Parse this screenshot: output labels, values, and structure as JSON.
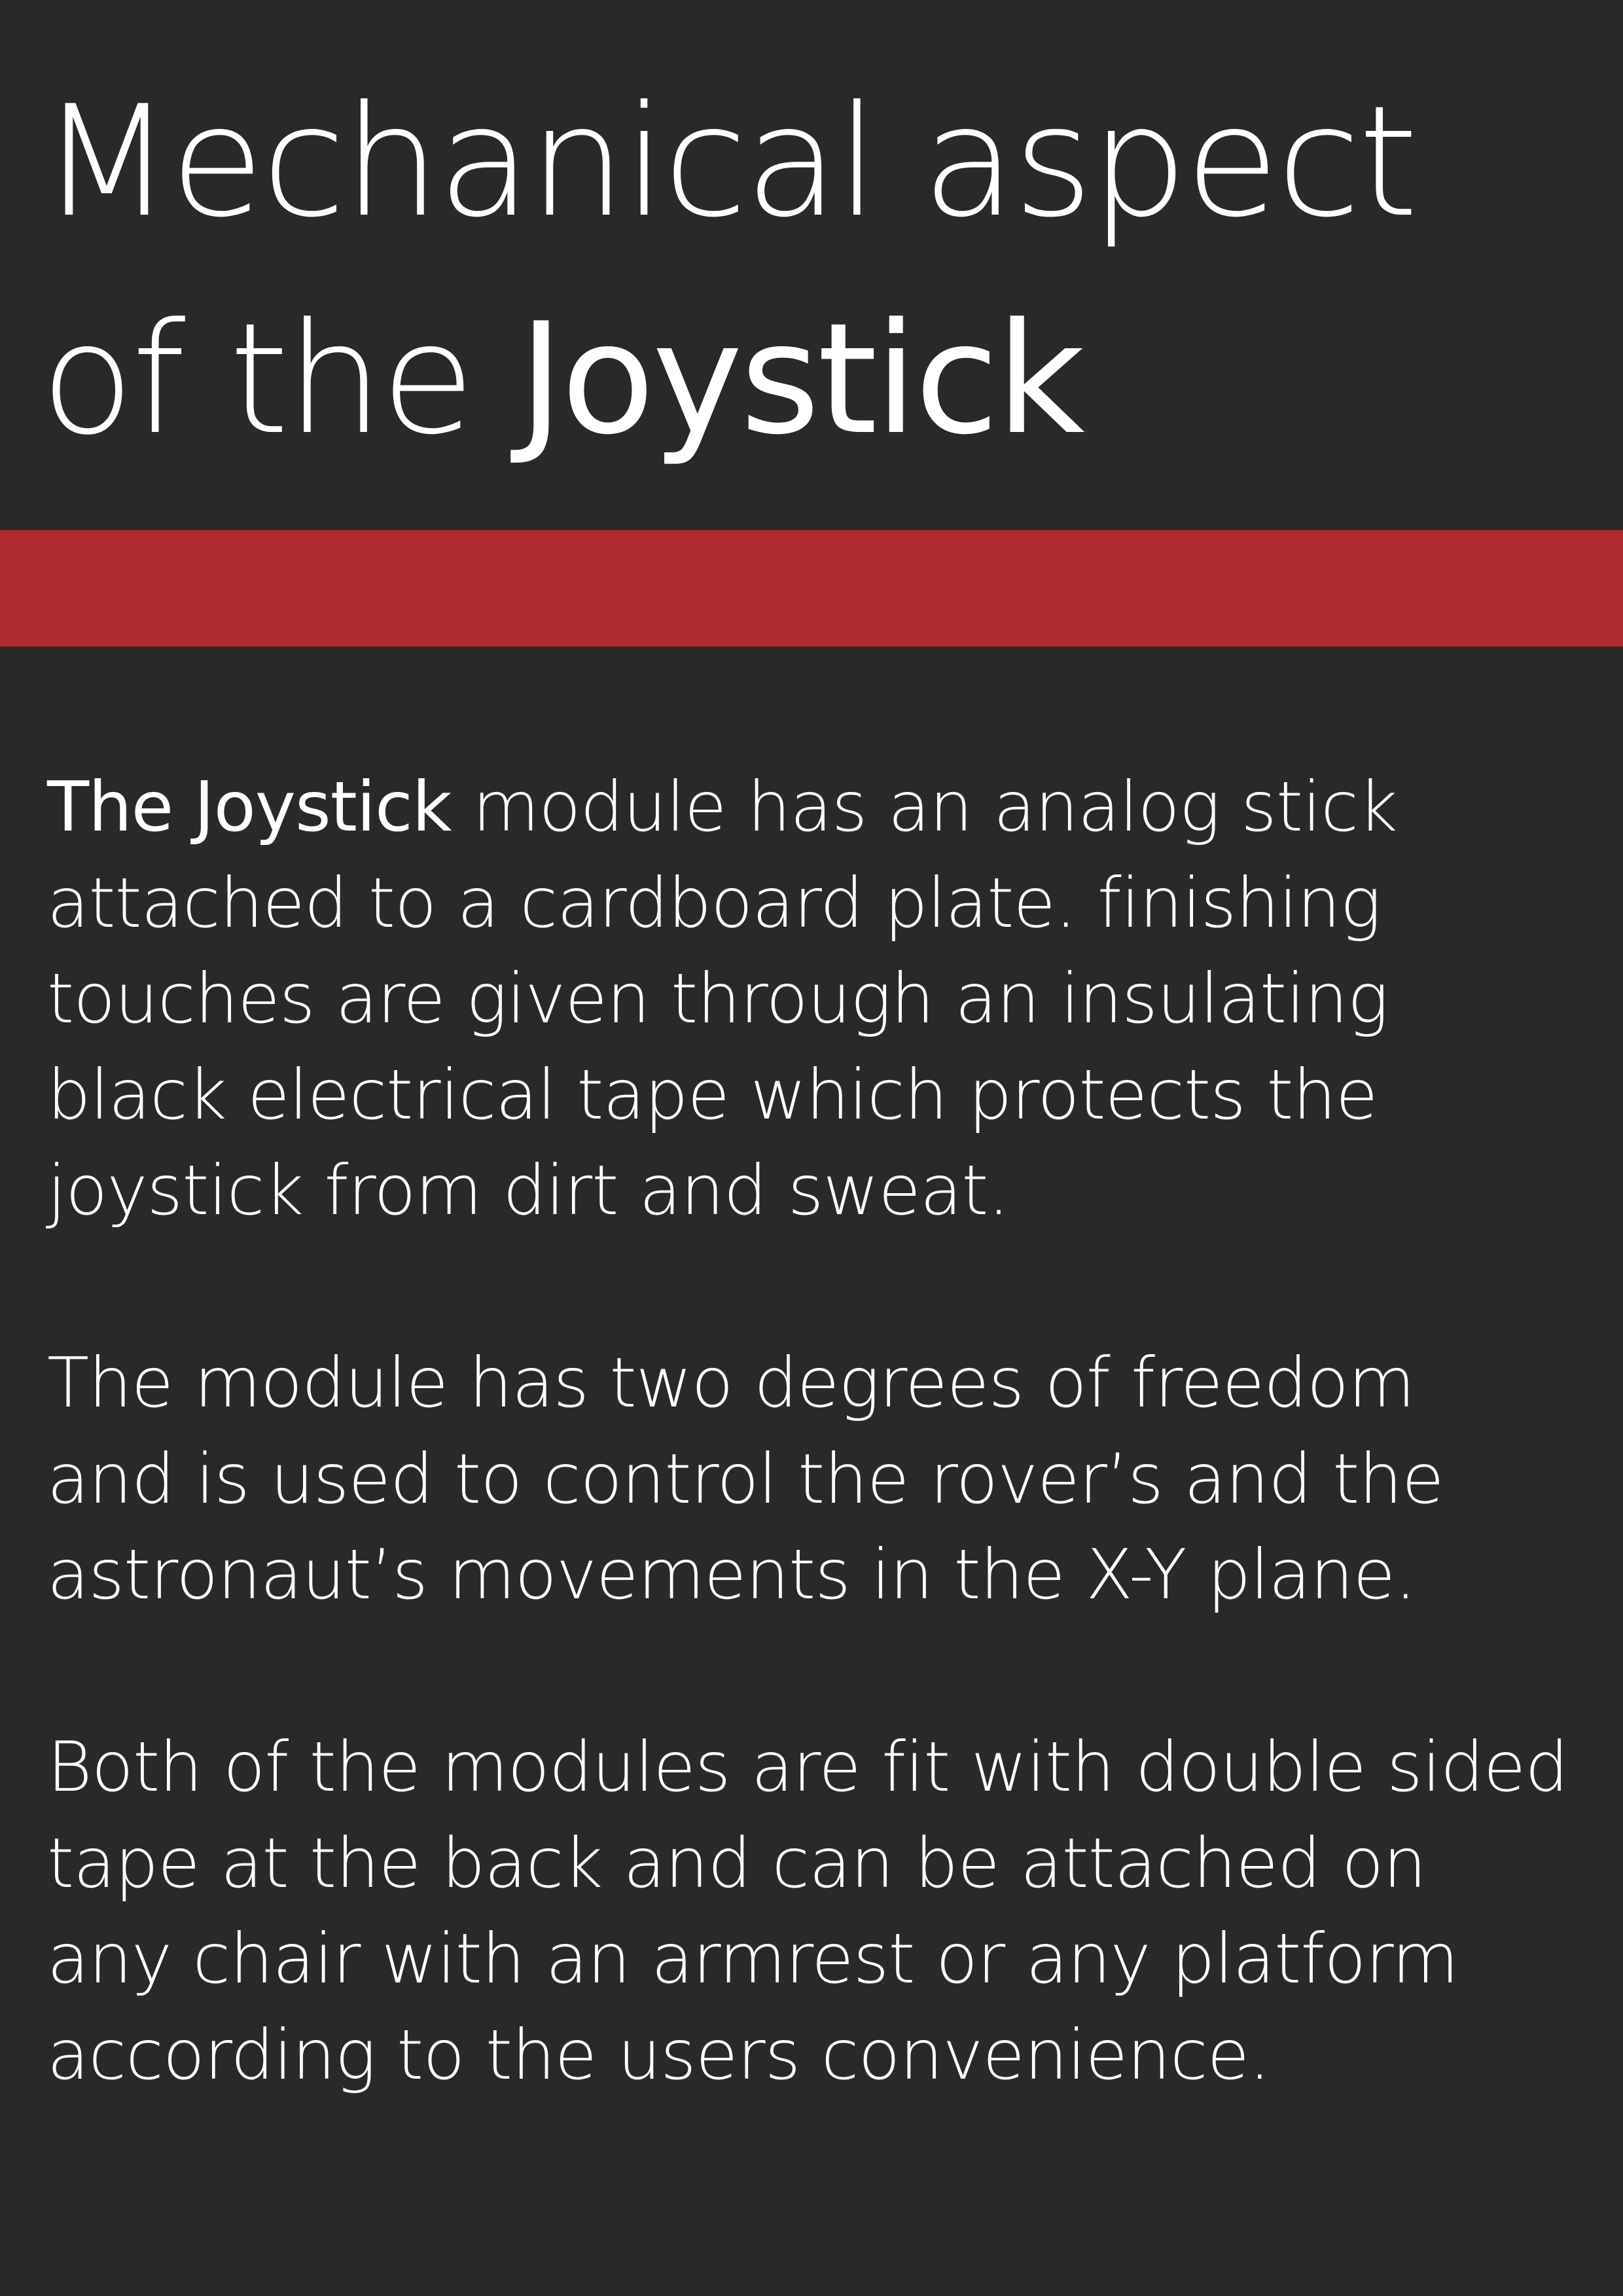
{
  "title": {
    "line1": "Mechanical aspect",
    "line2_prefix": "of the ",
    "line2_emphasis": "Joystick"
  },
  "colors": {
    "background": "#292929",
    "accent_band": "#b02b30",
    "text": "#ffffff"
  },
  "paragraphs": [
    {
      "lead": "The Joystick",
      "lines": [
        " module has an analog stick",
        "attached to a cardboard plate. finishing",
        "touches are given through an insulating",
        "black electrical tape which protects the",
        "joystick from dirt and sweat."
      ]
    },
    {
      "lines": [
        "The module has two degrees of freedom",
        "and is used to control the rover’s and the",
        "astronaut’s movements in the X-Y plane."
      ]
    },
    {
      "lines": [
        "Both of the modules are fit with double sided",
        "tape at the back and can be attached on",
        "any chair with an armrest or any platform",
        "according to the users convenience."
      ]
    }
  ]
}
